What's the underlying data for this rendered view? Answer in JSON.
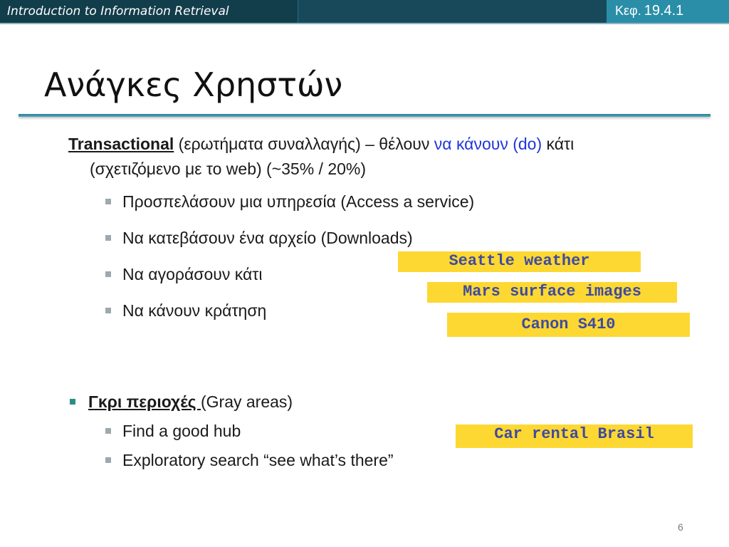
{
  "header": {
    "course_title": "Introduction to Information Retrieval",
    "chapter_prefix": "Κεφ.",
    "chapter_number": "19.4.1"
  },
  "slide": {
    "title": "Ανάγκες Χρηστών",
    "page_number": "6"
  },
  "transactional": {
    "term": "Transactional",
    "text_before": " (ερωτήματα συναλλαγής) – θέλουν ",
    "highlight": "να κάνουν (do)",
    "text_after": " κάτι",
    "line2": "(σχετιζόμενο με το web) (~35% / 20%)",
    "items": [
      "Προσπελάσουν μια υπηρεσία (Access a  service)",
      "Να κατεβάσουν ένα αρχείο (Downloads)",
      "Να αγοράσουν κάτι",
      "Να κάνουν κράτηση"
    ]
  },
  "gray_areas": {
    "term": "Γκρι περιοχές ",
    "text": "(Gray areas)",
    "items": [
      "Find a good hub",
      "Exploratory search “see what’s there”"
    ]
  },
  "example_queries": [
    "Seattle weather",
    "Mars surface images",
    "Canon S410",
    "Car rental Brasil"
  ],
  "colors": {
    "header_bg": "#17495a",
    "header_accent": "#2a8ea8",
    "query_box": "#fdd832",
    "query_text": "#3f4aa0",
    "highlight_blue": "#1f36d8"
  }
}
